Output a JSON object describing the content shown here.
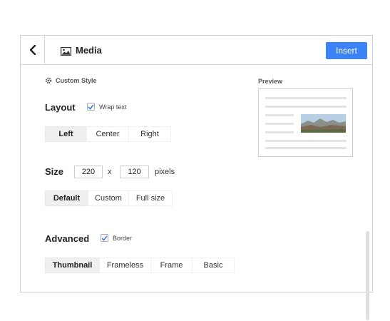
{
  "header": {
    "back_icon": "chevron-left-icon",
    "media_icon": "image-icon",
    "title": "Media",
    "insert_label": "Insert",
    "accent": "#3b82f6"
  },
  "custom_style": {
    "icon": "gear-icon",
    "label": "Custom Style"
  },
  "layout": {
    "label": "Layout",
    "wrap_text": {
      "label": "Wrap text",
      "checked": true
    },
    "options": [
      "Left",
      "Center",
      "Right"
    ],
    "selected": "Left"
  },
  "size": {
    "label": "Size",
    "width": "220",
    "separator": "x",
    "height": "120",
    "unit": "pixels",
    "options": [
      "Default",
      "Custom",
      "Full size"
    ],
    "selected": "Default"
  },
  "advanced": {
    "label": "Advanced",
    "border": {
      "label": "Border",
      "checked": true
    },
    "options": [
      "Thumbnail",
      "Frameless",
      "Frame",
      "Basic"
    ],
    "selected": "Thumbnail"
  },
  "preview": {
    "label": "Preview"
  }
}
